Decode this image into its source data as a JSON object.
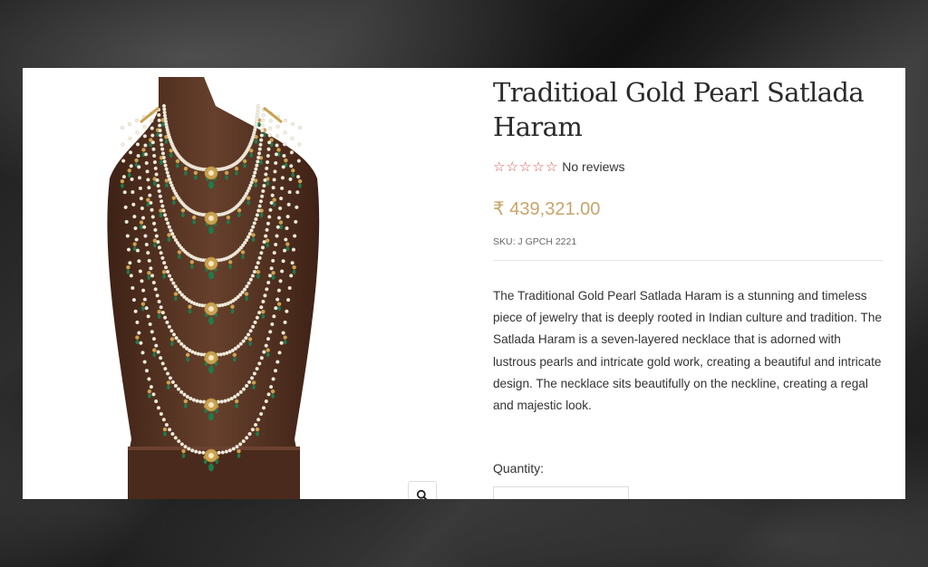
{
  "product": {
    "title": "Traditioal Gold Pearl Satlada Haram",
    "rating": {
      "stars": 0,
      "max_stars": 5,
      "reviews_text": "No reviews"
    },
    "price": "₹ 439,321.00",
    "sku": "SKU: J GPCH 2221",
    "description": "The Traditional Gold Pearl Satlada Haram is a stunning and timeless piece of jewelry that is deeply rooted in Indian culture and tradition. The Satlada Haram is a seven-layered necklace that is adorned with lustrous pearls and intricate gold work, creating a beautiful and intricate design. The necklace sits beautifully on the neckline, creating a regal and majestic look.",
    "quantity_label": "Quantity:"
  },
  "icons": {
    "zoom": "magnifier-icon",
    "star": "star-outline-icon"
  },
  "colors": {
    "price": "#c9a46a",
    "stars": "#d9574f",
    "bust": "#5a3322",
    "pearl": "#f3ede0",
    "emerald": "#1f7a4c",
    "gold": "#c9a24f"
  }
}
